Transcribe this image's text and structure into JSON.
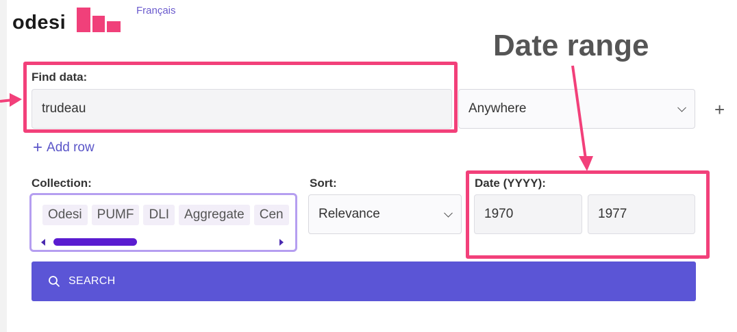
{
  "header": {
    "brand_name": "odesi",
    "language_link": "Français",
    "logo_color": "#f0407a"
  },
  "annotation": {
    "title": "Date range",
    "highlight_color": "#f2407a",
    "title_color": "#555555"
  },
  "find": {
    "label": "Find data:",
    "value": "trudeau",
    "scope_selected": "Anywhere",
    "add_field_symbol": "+"
  },
  "add_row": {
    "label": "Add row"
  },
  "collection": {
    "label": "Collection:",
    "chips": [
      "Odesi",
      "PUMF",
      "DLI",
      "Aggregate",
      "Cen"
    ],
    "scroll_fraction": 0.33,
    "border_color": "#b59ef0"
  },
  "sort": {
    "label": "Sort:",
    "selected": "Relevance"
  },
  "date": {
    "label": "Date (YYYY):",
    "from": "1970",
    "to": "1977"
  },
  "search": {
    "label": "SEARCH",
    "color": "#5b55d6"
  }
}
